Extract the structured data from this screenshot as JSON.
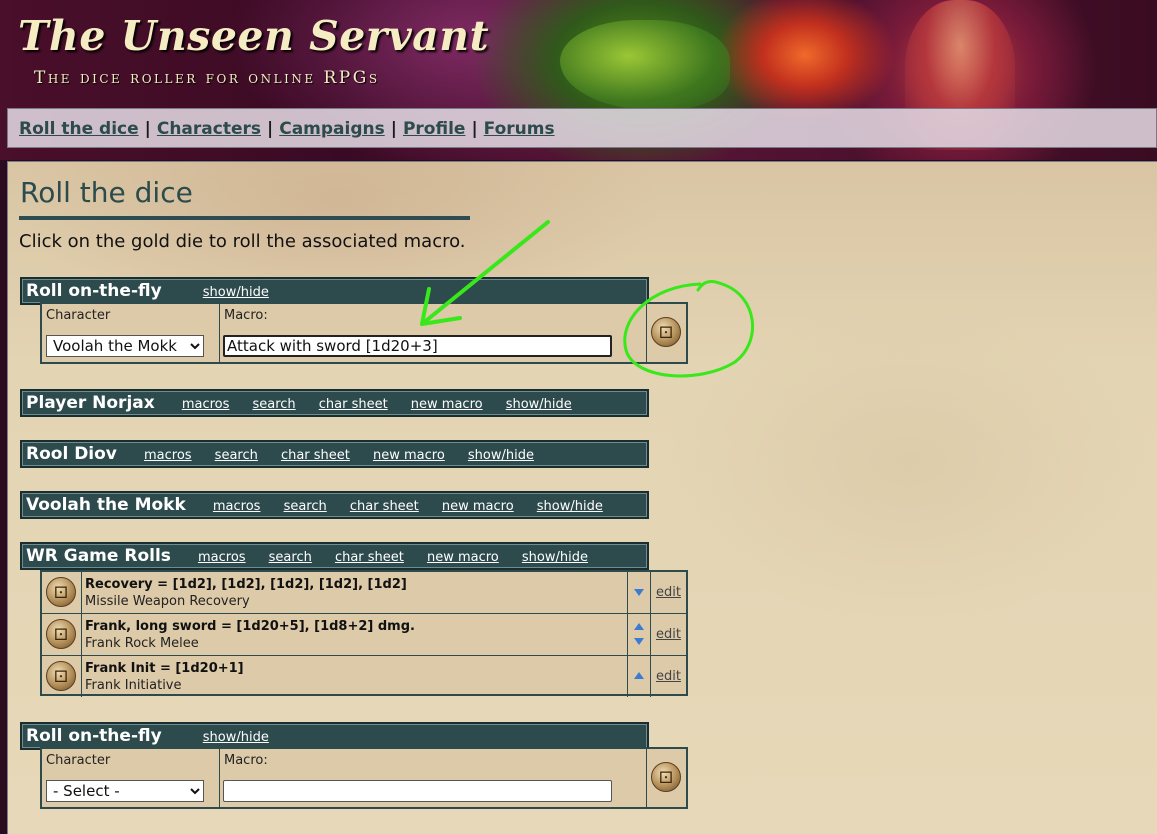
{
  "header": {
    "title": "The Unseen Servant",
    "subtitle": "The dice roller for online RPGs"
  },
  "nav": {
    "items": [
      "Roll the dice",
      "Characters",
      "Campaigns",
      "Profile",
      "Forums"
    ],
    "separator": "|"
  },
  "page": {
    "title": "Roll the dice",
    "intro": "Click on the gold die to roll the associated macro."
  },
  "otf_top": {
    "title": "Roll on-the-fly",
    "toggle": "show/hide",
    "character_label": "Character",
    "character_value": "Voolah the Mokk",
    "macro_label": "Macro:",
    "macro_value": "Attack with sword [1d20+3]"
  },
  "link_labels": {
    "macros": "macros",
    "search": "search",
    "char_sheet": "char sheet",
    "new_macro": "new macro",
    "toggle": "show/hide"
  },
  "characters": [
    {
      "name": "Player Norjax"
    },
    {
      "name": "Rool Diov"
    },
    {
      "name": "Voolah the Mokk"
    },
    {
      "name": "WR Game Rolls"
    }
  ],
  "macros": [
    {
      "title": "Recovery = [1d2], [1d2], [1d2], [1d2], [1d2]",
      "subtitle": "Missile Weapon Recovery",
      "edit": "edit"
    },
    {
      "title": "Frank, long sword = [1d20+5], [1d8+2] dmg.",
      "subtitle": "Frank Rock Melee",
      "edit": "edit"
    },
    {
      "title": "Frank Init = [1d20+1]",
      "subtitle": "Frank Initiative",
      "edit": "edit"
    }
  ],
  "otf_bottom": {
    "title": "Roll on-the-fly",
    "toggle": "show/hide",
    "character_label": "Character",
    "character_value": "- Select -",
    "macro_label": "Macro:",
    "macro_value": ""
  },
  "colors": {
    "panel_bar": "#2d4a4d",
    "annotation": "#38e81a",
    "arrow_buttons": "#3d7bd1"
  }
}
